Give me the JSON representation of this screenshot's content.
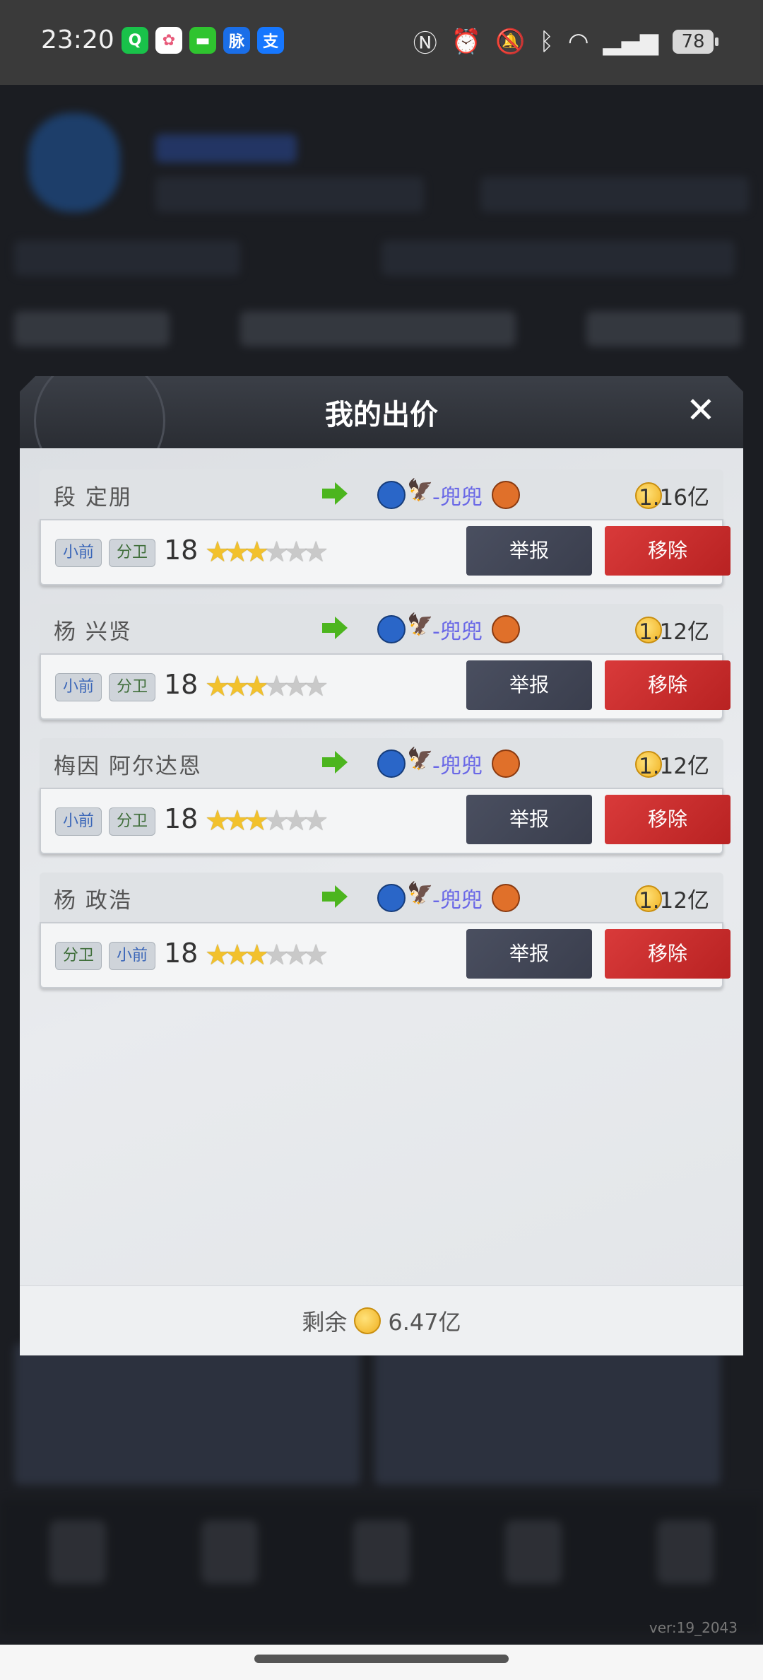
{
  "status_bar": {
    "time": "23:20",
    "apps": [
      {
        "icon": "qq-icon",
        "glyph": "Q",
        "color": "#19c24a"
      },
      {
        "icon": "photos-icon",
        "glyph": "✿",
        "color": "#e85a7a"
      },
      {
        "icon": "messages-icon",
        "glyph": "▬",
        "color": "#2fc42f"
      },
      {
        "icon": "maimai-icon",
        "glyph": "脉",
        "color": "#1a6ee8"
      },
      {
        "icon": "alipay-icon",
        "glyph": "支",
        "color": "#1677ff"
      }
    ],
    "battery": "78"
  },
  "modal": {
    "title": "我的出价",
    "close_label": "✕",
    "bids": [
      {
        "name": "段 定朋",
        "team": "-兜兜",
        "price": "1.16亿",
        "tags": [
          "小前",
          "分卫"
        ],
        "age": "18",
        "stars": "★★★★★★",
        "report": "举报",
        "remove": "移除"
      },
      {
        "name": "杨 兴贤",
        "team": "-兜兜",
        "price": "1.12亿",
        "tags": [
          "小前",
          "分卫"
        ],
        "age": "18",
        "stars": "★★★★★★",
        "report": "举报",
        "remove": "移除"
      },
      {
        "name": "梅因 阿尔达恩",
        "team": "-兜兜",
        "price": "1.12亿",
        "tags": [
          "小前",
          "分卫"
        ],
        "age": "18",
        "stars": "★★★★★★",
        "report": "举报",
        "remove": "移除"
      },
      {
        "name": "杨 政浩",
        "team": "-兜兜",
        "price": "1.12亿",
        "tags": [
          "分卫",
          "小前"
        ],
        "age": "18",
        "stars": "★★★★★★",
        "report": "举报",
        "remove": "移除"
      }
    ],
    "footer": {
      "label": "剩余",
      "amount": "6.47亿"
    }
  },
  "version": "ver:19_2043"
}
